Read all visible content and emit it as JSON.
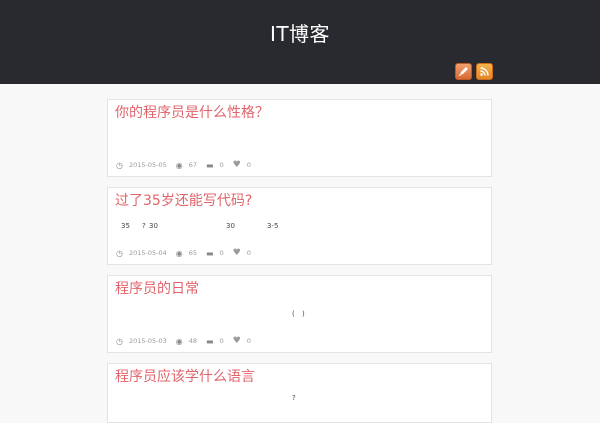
{
  "site": {
    "title": "IT博客"
  },
  "header_icons": [
    "pen-icon",
    "rss-icon"
  ],
  "posts": [
    {
      "title": "你的程序员是什么性格？",
      "excerpt": [],
      "date": "2015-05-05",
      "views": "67",
      "comments": "0",
      "likes": "0"
    },
    {
      "title": "过了35岁还能写代码?",
      "excerpt": [
        "35",
        "?",
        "30",
        "30",
        "3-5"
      ],
      "date": "2015-05-04",
      "views": "65",
      "comments": "0",
      "likes": "0"
    },
    {
      "title": "程序员的日常",
      "excerpt": [
        "(",
        ")"
      ],
      "date": "2015-05-03",
      "views": "48",
      "comments": "0",
      "likes": "0"
    },
    {
      "title": "程序员应该学什么语言",
      "excerpt": [
        "?"
      ],
      "date": "",
      "views": "",
      "comments": "",
      "likes": ""
    }
  ]
}
